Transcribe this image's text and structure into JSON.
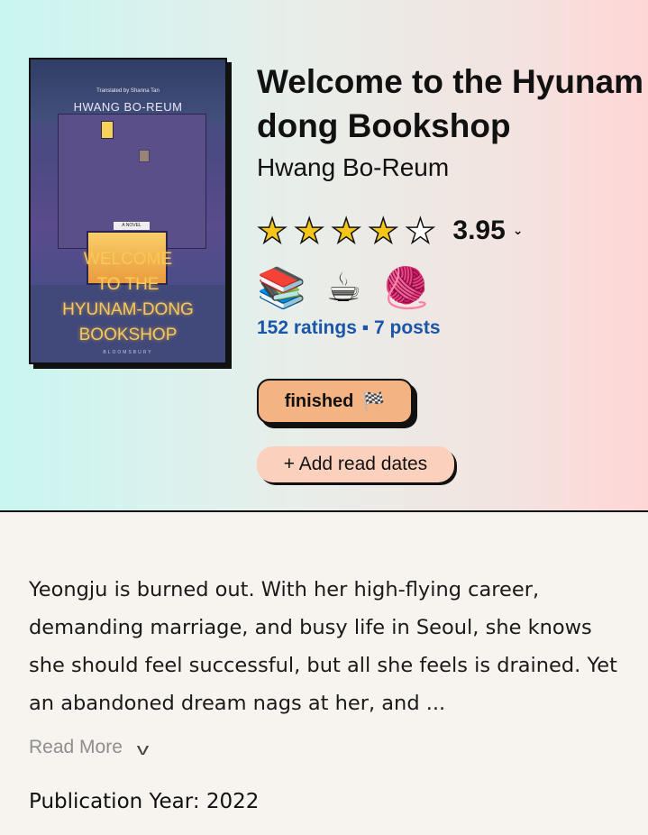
{
  "cover": {
    "translated_by": "Translated by Shanna Tan",
    "author": "HWANG BO-REUM",
    "novel_tag": "A NOVEL",
    "title_lines": [
      "WELCOME",
      "TO THE",
      "HYUNAM-DONG",
      "BOOKSHOP"
    ],
    "publisher": "BLOOMSBURY"
  },
  "book": {
    "title": "Welcome to the Hyunam-dong Bookshop",
    "author": "Hwang Bo-Reum"
  },
  "rating": {
    "value": "3.95",
    "stars_filled": 4,
    "stars_total": 5
  },
  "moods": [
    "📚",
    "☕",
    "🧶"
  ],
  "stats": {
    "text": "152 ratings ▪ 7 posts"
  },
  "status": {
    "label": "finished",
    "icon": "🏁"
  },
  "read_dates": {
    "label": "+ Add read dates"
  },
  "description": {
    "text": "Yeongju is burned out. With her high-flying career, demanding marriage, and busy life in Seoul, she knows she should feel successful, but all she feels is drained. Yet an abandoned dream nags at her, and ...",
    "read_more": "Read More"
  },
  "publication": {
    "text": "Publication Year: 2022"
  }
}
